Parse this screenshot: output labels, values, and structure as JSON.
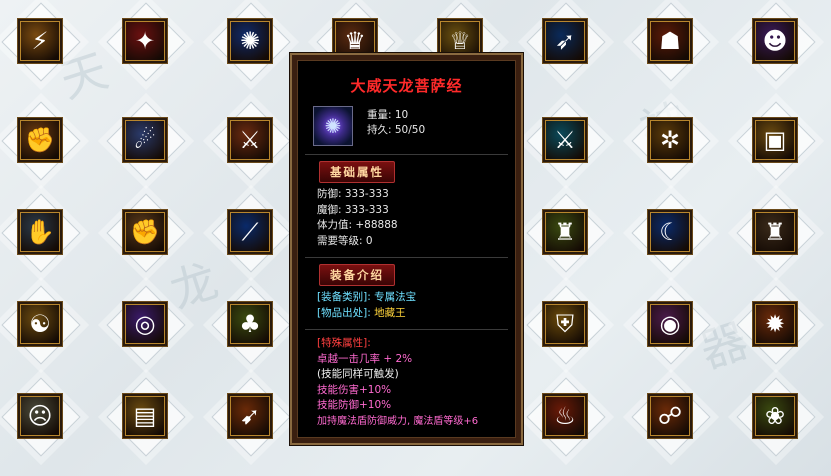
{
  "tooltip": {
    "title": "大威天龙菩萨经",
    "weight": "重量: 10",
    "durability": "持久: 50/50",
    "base_header": "基础属性",
    "base_stats": [
      "防御: 333-333",
      "魔御: 333-333",
      "体力值: +88888",
      "需要等级: 0"
    ],
    "intro_header": "装备介绍",
    "category_label": "[装备类别]: ",
    "category_value": "专属法宝",
    "source_label": "[物品出处]: ",
    "source_value": "地藏王",
    "special_header": "[特殊属性]:",
    "special_lines": [
      "卓越一击几率 + 2%",
      "(技能同样可触发)",
      "技能伤害+10%",
      "技能防御+10%",
      "加持魔法盾防御威力, 魔法盾等级+6"
    ],
    "item_icon": "blue-orb-icon"
  },
  "slots": [
    {
      "name": "golden-claw-icon",
      "glyph": "⚡",
      "color": "#7a4a10"
    },
    {
      "name": "crimson-dragon-icon",
      "glyph": "✦",
      "color": "#6a1010"
    },
    {
      "name": "blue-energy-orb-icon",
      "glyph": "✺",
      "color": "#102a6a"
    },
    {
      "name": "helmet-icon",
      "glyph": "♛",
      "color": "#5a2a10"
    },
    {
      "name": "golden-crown-icon",
      "glyph": "♕",
      "color": "#6a5010"
    },
    {
      "name": "blue-lightning-spear-icon",
      "glyph": "➶",
      "color": "#0a2a5a"
    },
    {
      "name": "fire-warrior-icon",
      "glyph": "☗",
      "color": "#5a1a08"
    },
    {
      "name": "purple-mask-icon",
      "glyph": "☻",
      "color": "#3a1a5a"
    },
    {
      "name": "armored-fist-icon",
      "glyph": "✊",
      "color": "#6a3a10"
    },
    {
      "name": "blue-orb-staff-icon",
      "glyph": "☄",
      "color": "#2a3a6a"
    },
    {
      "name": "flame-sword-icon",
      "glyph": "⚔",
      "color": "#6a2a10"
    },
    {
      "name": "cyan-sword-icon",
      "glyph": "⚔",
      "color": "#0a4a5a"
    },
    {
      "name": "golden-wheel-icon",
      "glyph": "✲",
      "color": "#5a3a0a"
    },
    {
      "name": "treasure-chest-icon",
      "glyph": "▣",
      "color": "#6a4a10"
    },
    {
      "name": "gauntlet-icon",
      "glyph": "✋",
      "color": "#2a3a4a"
    },
    {
      "name": "punch-fist-icon",
      "glyph": "✊",
      "color": "#5a3a1a"
    },
    {
      "name": "blue-blade-slash-icon",
      "glyph": "⟋",
      "color": "#0a2a6a"
    },
    {
      "name": "jade-guardian-icon",
      "glyph": "♜",
      "color": "#3a4a10"
    },
    {
      "name": "blue-crescent-icon",
      "glyph": "☾",
      "color": "#0a2a6a"
    },
    {
      "name": "dark-tower-icon",
      "glyph": "♜",
      "color": "#3a2a1a"
    },
    {
      "name": "yin-yang-icon",
      "glyph": "☯",
      "color": "#6a4a10"
    },
    {
      "name": "purple-vortex-icon",
      "glyph": "◎",
      "color": "#3a1a6a"
    },
    {
      "name": "golden-tree-icon",
      "glyph": "♣",
      "color": "#3a4a10"
    },
    {
      "name": "golden-shield-icon",
      "glyph": "⛨",
      "color": "#6a4a0a"
    },
    {
      "name": "purple-orb-altar-icon",
      "glyph": "◉",
      "color": "#4a1a4a"
    },
    {
      "name": "fire-swirl-icon",
      "glyph": "✹",
      "color": "#6a2a0a"
    },
    {
      "name": "stone-face-icon",
      "glyph": "☹",
      "color": "#4a4a3a"
    },
    {
      "name": "golden-scroll-icon",
      "glyph": "▤",
      "color": "#6a4a10"
    },
    {
      "name": "fire-arrow-icon",
      "glyph": "➹",
      "color": "#6a2a08"
    },
    {
      "name": "flame-spirit-icon",
      "glyph": "♨",
      "color": "#6a1a08"
    },
    {
      "name": "fire-shadow-icon",
      "glyph": "☍",
      "color": "#6a2a08"
    },
    {
      "name": "lotus-flower-icon",
      "glyph": "❀",
      "color": "#3a4a10"
    }
  ]
}
